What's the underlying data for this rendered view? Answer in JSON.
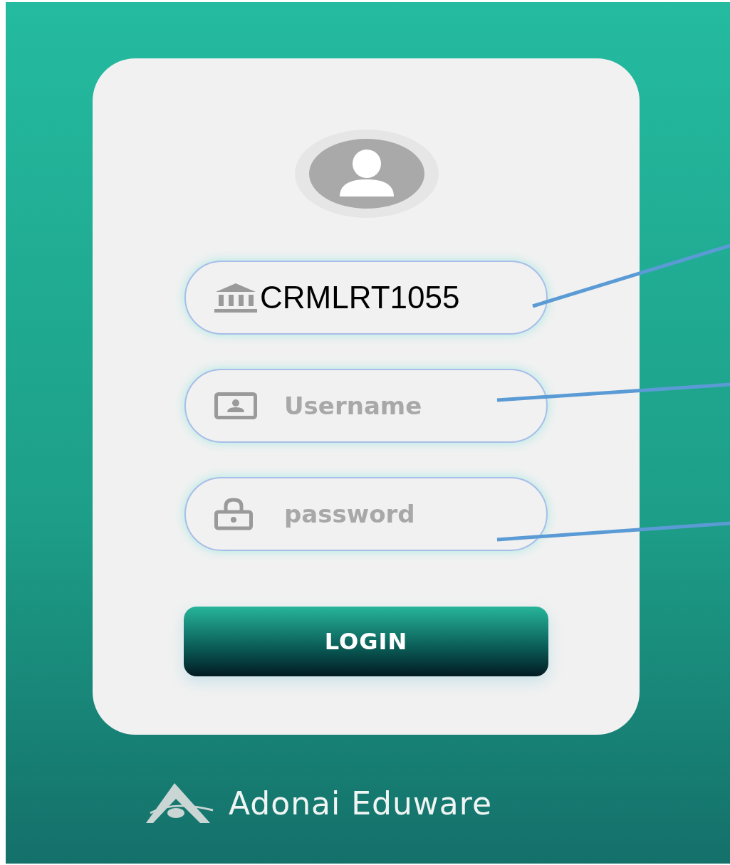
{
  "fields": [
    {
      "kind": "school",
      "value": "CRMLRT1055"
    },
    {
      "kind": "user",
      "placeholder": "Username"
    },
    {
      "kind": "lock",
      "placeholder": "password"
    }
  ],
  "login_button": {
    "label": "LOGIN"
  },
  "brand": {
    "name": "Adonai Eduware"
  }
}
